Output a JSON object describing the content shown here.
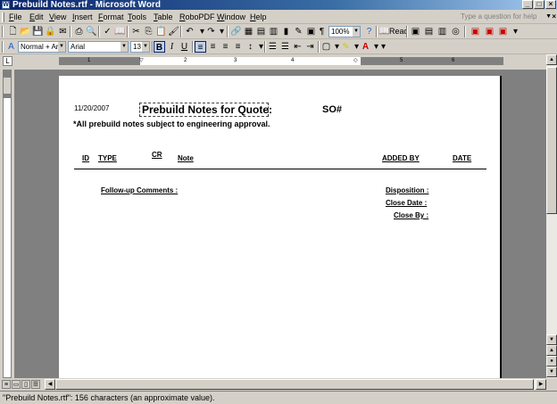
{
  "window": {
    "title": "Prebuild Notes.rtf - Microsoft Word",
    "app_icon": "W"
  },
  "menu": {
    "items": [
      {
        "acc": "F",
        "rest": "ile"
      },
      {
        "acc": "E",
        "rest": "dit"
      },
      {
        "acc": "V",
        "rest": "iew"
      },
      {
        "acc": "I",
        "rest": "nsert"
      },
      {
        "acc": "F",
        "rest": "ormat",
        "pre": ""
      },
      {
        "acc": "T",
        "rest": "ools"
      },
      {
        "acc": "T",
        "rest": "able"
      },
      {
        "acc": "R",
        "rest": "oboPDF"
      },
      {
        "acc": "W",
        "rest": "indow"
      },
      {
        "acc": "H",
        "rest": "elp"
      }
    ],
    "help_placeholder": "Type a question for help"
  },
  "toolbar1": {
    "zoom": "100%",
    "read_label": "Read"
  },
  "toolbar2": {
    "style": "Normal + Aria",
    "font": "Arial",
    "size": "13",
    "bold": "B",
    "italic": "I",
    "underline": "U"
  },
  "ruler": {
    "nums": [
      "1",
      "2",
      "3",
      "4",
      "5",
      "6"
    ]
  },
  "document": {
    "date": "11/20/2007",
    "title": "Prebuild Notes for Quote:",
    "so_label": "SO#",
    "note": "*All prebuild notes subject to engineering approval.",
    "columns": {
      "id": "ID",
      "type": "TYPE",
      "cr": "CR",
      "note": "Note",
      "added_by": "ADDED BY",
      "date": "DATE"
    },
    "followup_label": "Follow-up Comments :",
    "disposition_label": "Disposition :",
    "close_date_label": "Close  Date :",
    "close_by_label": "Close By :"
  },
  "status": {
    "text": "\"Prebuild Notes.rtf\": 156 characters (an approximate value)."
  }
}
